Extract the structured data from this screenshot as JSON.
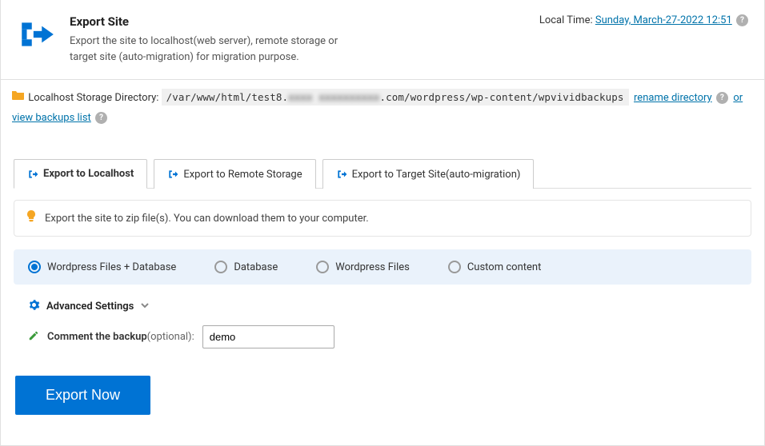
{
  "header": {
    "title": "Export Site",
    "subtitle": "Export the site to localhost(web server), remote storage or target site (auto-migration) for migration purpose."
  },
  "local_time": {
    "label": "Local Time: ",
    "value": "Sunday, March-27-2022 12:51"
  },
  "storage": {
    "label": "Localhost Storage Directory:",
    "path_prefix": "/var/www/html/test8.",
    "path_blur": "xxxx xxxxxxxxxx",
    "path_suffix": ".com/wordpress/wp-content/wpvividbackups",
    "rename_link": "rename directory",
    "view_link": "or view backups list"
  },
  "tabs": [
    {
      "label": "Export to Localhost"
    },
    {
      "label": "Export to Remote Storage"
    },
    {
      "label": "Export to Target Site(auto-migration)"
    }
  ],
  "info_text": "Export the site to zip file(s). You can download them to your computer.",
  "backup_options": [
    {
      "label": "Wordpress Files + Database",
      "checked": true
    },
    {
      "label": "Database",
      "checked": false
    },
    {
      "label": "Wordpress Files",
      "checked": false
    },
    {
      "label": "Custom content",
      "checked": false
    }
  ],
  "advanced_label": "Advanced Settings",
  "comment": {
    "label_strong": "Comment the backup",
    "label_opt": "(optional):",
    "value": "demo"
  },
  "export_button": "Export Now"
}
